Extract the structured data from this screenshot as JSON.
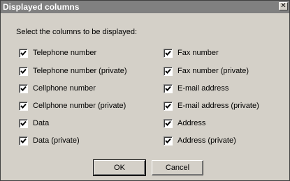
{
  "dialog": {
    "title": "Displayed columns",
    "close_glyph": "✕",
    "instructions": "Select the columns to be displayed:"
  },
  "columns": [
    {
      "label": "Telephone number",
      "checked": true
    },
    {
      "label": "Telephone number (private)",
      "checked": true
    },
    {
      "label": "Cellphone number",
      "checked": true
    },
    {
      "label": "Cellphone number (private)",
      "checked": true
    },
    {
      "label": "Data",
      "checked": true
    },
    {
      "label": "Data (private)",
      "checked": true
    },
    {
      "label": "Fax number",
      "checked": true
    },
    {
      "label": "Fax number (private)",
      "checked": true
    },
    {
      "label": "E-mail address",
      "checked": true
    },
    {
      "label": "E-mail address (private)",
      "checked": true
    },
    {
      "label": "Address",
      "checked": true
    },
    {
      "label": "Address (private)",
      "checked": true
    }
  ],
  "buttons": {
    "ok": "OK",
    "cancel": "Cancel"
  },
  "colors": {
    "titlebar": "#808080",
    "dialog_bg": "#d4d0c8"
  },
  "icons": {
    "close": "close-icon",
    "check": "checkmark-icon"
  }
}
